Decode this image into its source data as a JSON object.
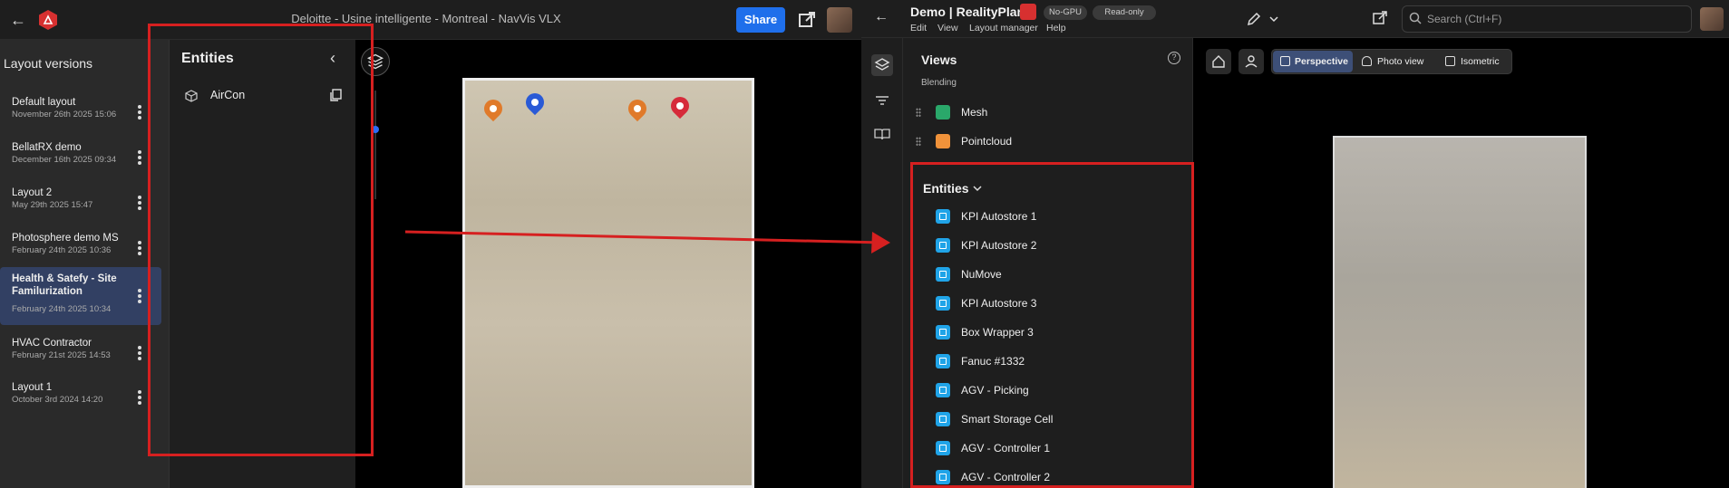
{
  "left_app": {
    "title": "Deloitte - Usine intelligente - Montreal - NavVis VLX",
    "share_label": "Share",
    "layout_versions": {
      "title": "Layout versions",
      "items": [
        {
          "name": "Default layout",
          "date": "November 26th 2025 15:06"
        },
        {
          "name": "BellatRX demo",
          "date": "December 16th 2025 09:34"
        },
        {
          "name": "Layout 2",
          "date": "May 29th 2025 15:47"
        },
        {
          "name": "Photosphere demo MS",
          "date": "February 24th 2025 10:36"
        },
        {
          "name": "Health & Satefy - Site Familurization",
          "date": "February 24th 2025 10:34"
        },
        {
          "name": "HVAC Contractor",
          "date": "February 21st 2025 14:53"
        },
        {
          "name": "Layout 1",
          "date": "October 3rd 2024 14:20"
        }
      ]
    },
    "entities": {
      "title": "Entities",
      "items": [
        {
          "label": "AirCon"
        }
      ]
    },
    "pins": [
      {
        "color": "#e07a2a"
      },
      {
        "color": "#2a5ad6"
      },
      {
        "color": "#e07a2a"
      },
      {
        "color": "#d62b3a"
      }
    ]
  },
  "right_app": {
    "app_name": "Demo | RealityPlan",
    "chips": [
      "No-GPU",
      "Read-only"
    ],
    "menu": [
      "Edit",
      "View",
      "Layout manager",
      "Help"
    ],
    "search_placeholder": "Search (Ctrl+F)",
    "views": {
      "title": "Views",
      "blending_label": "Blending",
      "blending_items": [
        {
          "label": "Mesh",
          "color": "#2aa86a"
        },
        {
          "label": "Pointcloud",
          "color": "#f0923a"
        }
      ]
    },
    "entities": {
      "title": "Entities",
      "items": [
        "KPI Autostore 1",
        "KPI Autostore 2",
        "NuMove",
        "KPI Autostore 3",
        "Box Wrapper 3",
        "Fanuc #1332",
        "AGV - Picking",
        "Smart Storage Cell",
        "AGV - Controller 1",
        "AGV - Controller 2"
      ]
    },
    "view_modes": [
      "Perspective",
      "Photo view",
      "Isometric"
    ]
  },
  "colors": {
    "accent": "#1f6feb",
    "highlight": "#d62020",
    "entity_icon": "#20a4e8"
  }
}
